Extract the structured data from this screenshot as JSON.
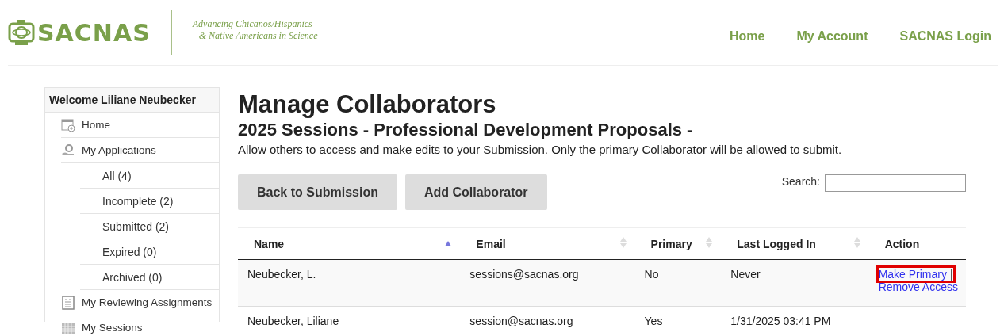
{
  "header": {
    "logo_text": "SACNAS",
    "tagline": [
      "Advancing Chicanos/Hispanics",
      "& Native Americans in Science"
    ],
    "nav": [
      {
        "label": "Home"
      },
      {
        "label": "My Account"
      },
      {
        "label": "SACNAS Login"
      }
    ]
  },
  "sidebar": {
    "welcome": "Welcome Liliane Neubecker",
    "items": [
      {
        "label": "Home"
      },
      {
        "label": "My Applications",
        "children": [
          {
            "label": "All (4)"
          },
          {
            "label": "Incomplete (2)"
          },
          {
            "label": "Submitted (2)"
          },
          {
            "label": "Expired (0)"
          },
          {
            "label": "Archived (0)"
          }
        ]
      },
      {
        "label": "My Reviewing Assignments"
      },
      {
        "label": "My Sessions"
      }
    ]
  },
  "main": {
    "title": "Manage Collaborators",
    "subtitle": "2025 Sessions - Professional Development Proposals -",
    "description": "Allow others to access and make edits to your Submission. Only the primary Collaborator will be allowed to submit.",
    "buttons": [
      "Back to Submission",
      "Add Collaborator"
    ],
    "search": {
      "label": "Search:"
    },
    "table": {
      "columns": [
        {
          "label": "Name",
          "sorted": true
        },
        {
          "label": "Email",
          "sorted": false
        },
        {
          "label": "Primary",
          "sorted": false
        },
        {
          "label": "Last Logged In",
          "sorted": false
        },
        {
          "label": "Action"
        }
      ],
      "rows": [
        {
          "cells": [
            "Neubecker, L.",
            "sessions@sacnas.org",
            "No",
            "Never"
          ],
          "actions": [
            {
              "label": "Make Primary",
              "highlighted": true
            },
            {
              "label": "Remove Access",
              "highlighted": false
            }
          ],
          "separator": "|"
        },
        {
          "cells": [
            "Neubecker, Liliane",
            "session@sacnas.org",
            "Yes",
            "1/31/2025 03:41 PM"
          ]
        }
      ]
    }
  }
}
